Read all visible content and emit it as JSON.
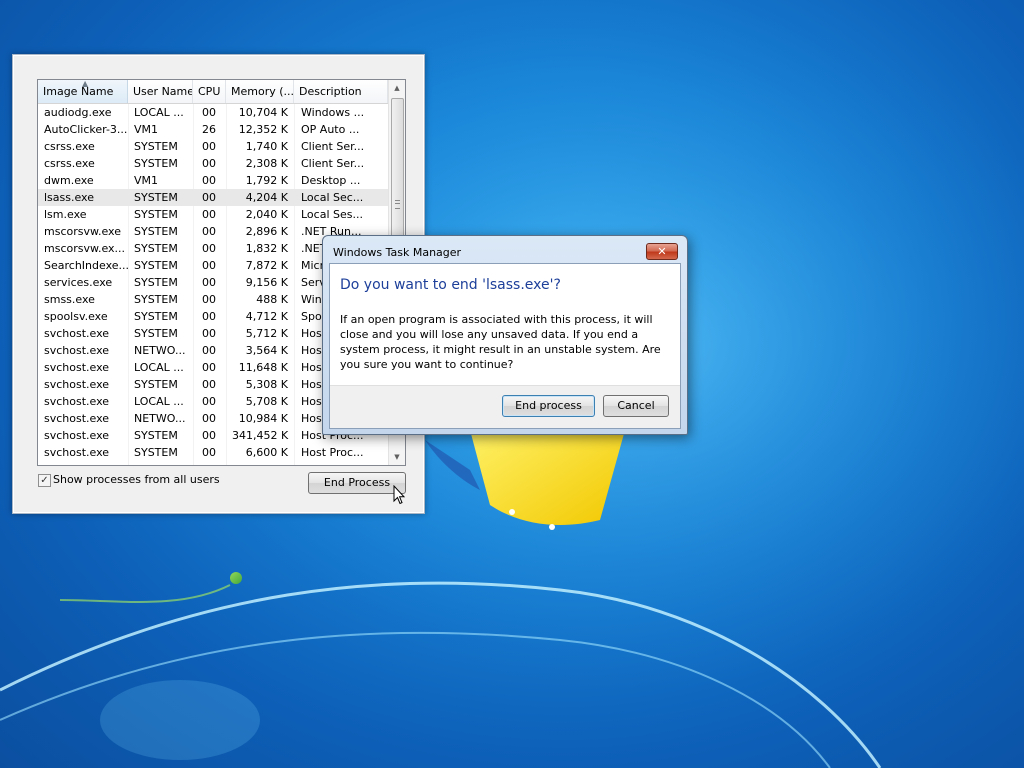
{
  "colors": {
    "desktop_blue": "#1883d6",
    "dialog_heading": "#1d3f9a",
    "close_red": "#c0391c"
  },
  "task_manager": {
    "columns": [
      "Image Name",
      "User Name",
      "CPU",
      "Memory (...",
      "Description"
    ],
    "sorted_column": "Image Name",
    "rows": [
      [
        "audiodg.exe",
        "LOCAL ...",
        "00",
        "10,704 K",
        "Windows ..."
      ],
      [
        "AutoClicker-3....",
        "VM1",
        "26",
        "12,352 K",
        "OP Auto ..."
      ],
      [
        "csrss.exe",
        "SYSTEM",
        "00",
        "1,740 K",
        "Client Ser..."
      ],
      [
        "csrss.exe",
        "SYSTEM",
        "00",
        "2,308 K",
        "Client Ser..."
      ],
      [
        "dwm.exe",
        "VM1",
        "00",
        "1,792 K",
        "Desktop ..."
      ],
      [
        "lsass.exe",
        "SYSTEM",
        "00",
        "4,204 K",
        "Local Sec..."
      ],
      [
        "lsm.exe",
        "SYSTEM",
        "00",
        "2,040 K",
        "Local Ses..."
      ],
      [
        "mscorsvw.exe",
        "SYSTEM",
        "00",
        "2,896 K",
        ".NET Run..."
      ],
      [
        "mscorsvw.ex...",
        "SYSTEM",
        "00",
        "1,832 K",
        ".NET Run..."
      ],
      [
        "SearchIndexe...",
        "SYSTEM",
        "00",
        "7,872 K",
        "Microsoft..."
      ],
      [
        "services.exe",
        "SYSTEM",
        "00",
        "9,156 K",
        "Services..."
      ],
      [
        "smss.exe",
        "SYSTEM",
        "00",
        "488 K",
        "Windows..."
      ],
      [
        "spoolsv.exe",
        "SYSTEM",
        "00",
        "4,712 K",
        "Spooler..."
      ],
      [
        "svchost.exe",
        "SYSTEM",
        "00",
        "5,712 K",
        "Host Proc..."
      ],
      [
        "svchost.exe",
        "NETWO...",
        "00",
        "3,564 K",
        "Host Proc..."
      ],
      [
        "svchost.exe",
        "LOCAL ...",
        "00",
        "11,648 K",
        "Host Proc..."
      ],
      [
        "svchost.exe",
        "SYSTEM",
        "00",
        "5,308 K",
        "Host Proc..."
      ],
      [
        "svchost.exe",
        "LOCAL ...",
        "00",
        "5,708 K",
        "Host Proc..."
      ],
      [
        "svchost.exe",
        "NETWO...",
        "00",
        "10,984 K",
        "Host Proc..."
      ],
      [
        "svchost.exe",
        "SYSTEM",
        "00",
        "341,452 K",
        "Host Proc..."
      ],
      [
        "svchost.exe",
        "SYSTEM",
        "00",
        "6,600 K",
        "Host Proc..."
      ]
    ],
    "selected_row": 5,
    "show_all_label": "Show processes from all users",
    "show_all_checked": "✓",
    "end_process_label": "End Process"
  },
  "dialog": {
    "title": "Windows Task Manager",
    "close_glyph": "✕",
    "heading": "Do you want to end 'lsass.exe'?",
    "message": "If an open program is associated with this process, it will close and you will lose any unsaved data. If you end a system process, it might result in an unstable system. Are you sure you want to continue?",
    "end_button": "End process",
    "cancel_button": "Cancel"
  },
  "icons": {
    "sort": "sort-ascending-icon",
    "scroll_up": "scroll-up-icon",
    "scroll_down": "scroll-down-icon",
    "close": "close-icon",
    "cursor": "mouse-pointer-icon"
  }
}
